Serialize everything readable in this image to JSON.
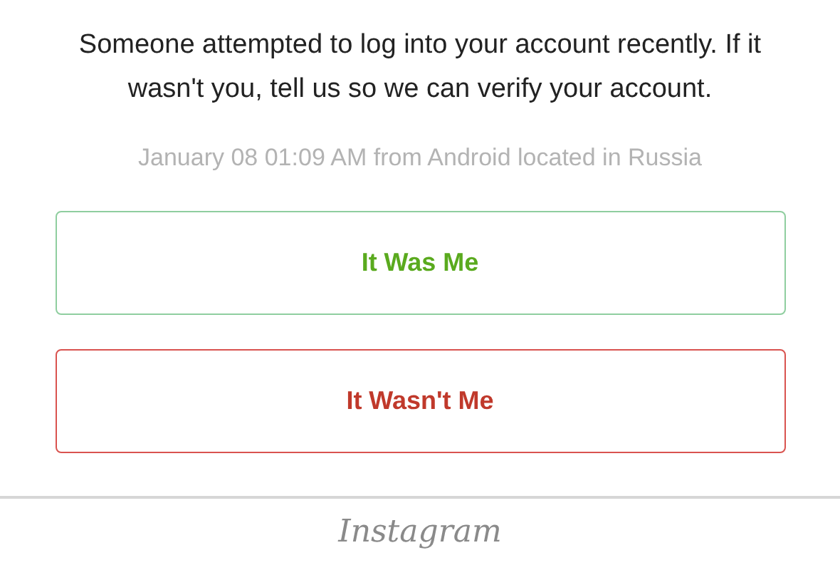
{
  "message": "Someone attempted to log into your account recently. If it wasn't you, tell us so we can verify your account.",
  "details": "January 08 01:09 AM from Android located in Russia",
  "buttons": [
    {
      "label": "It Was Me",
      "kind": "confirm"
    },
    {
      "label": "It Wasn't Me",
      "kind": "deny"
    }
  ],
  "footer": {
    "logo": "Instagram"
  }
}
